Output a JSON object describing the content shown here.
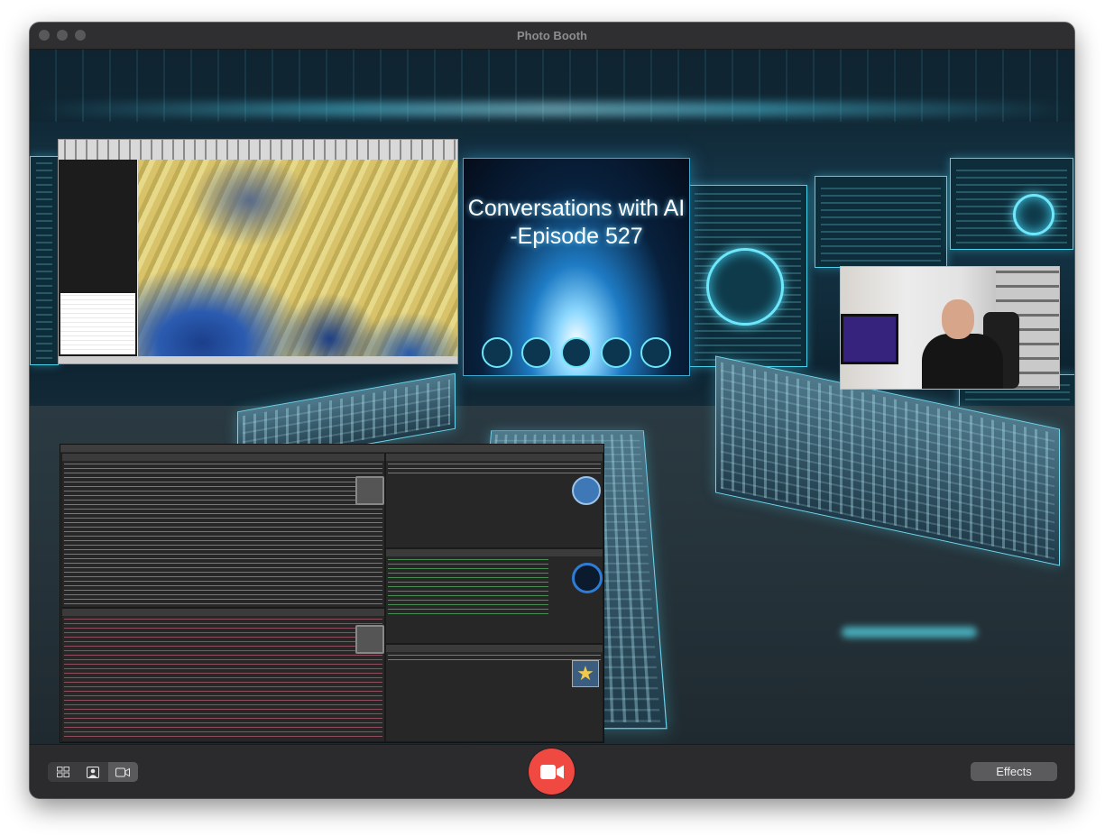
{
  "window": {
    "title": "Photo Booth"
  },
  "preview": {
    "screen_text": "Conversations with AI\n-Episode 527"
  },
  "toolbar": {
    "layout_buttons": [
      {
        "name": "grid-view-button",
        "icon": "grid-icon",
        "selected": false
      },
      {
        "name": "portrait-photo-button",
        "icon": "portrait-icon",
        "selected": false
      },
      {
        "name": "video-mode-button",
        "icon": "video-camera-icon",
        "selected": true
      }
    ],
    "record_icon": "video-camera-icon",
    "effects_label": "Effects"
  },
  "colors": {
    "record": "#f04942",
    "window_bg": "#2b2b2d",
    "title_text": "#8d8d90"
  }
}
